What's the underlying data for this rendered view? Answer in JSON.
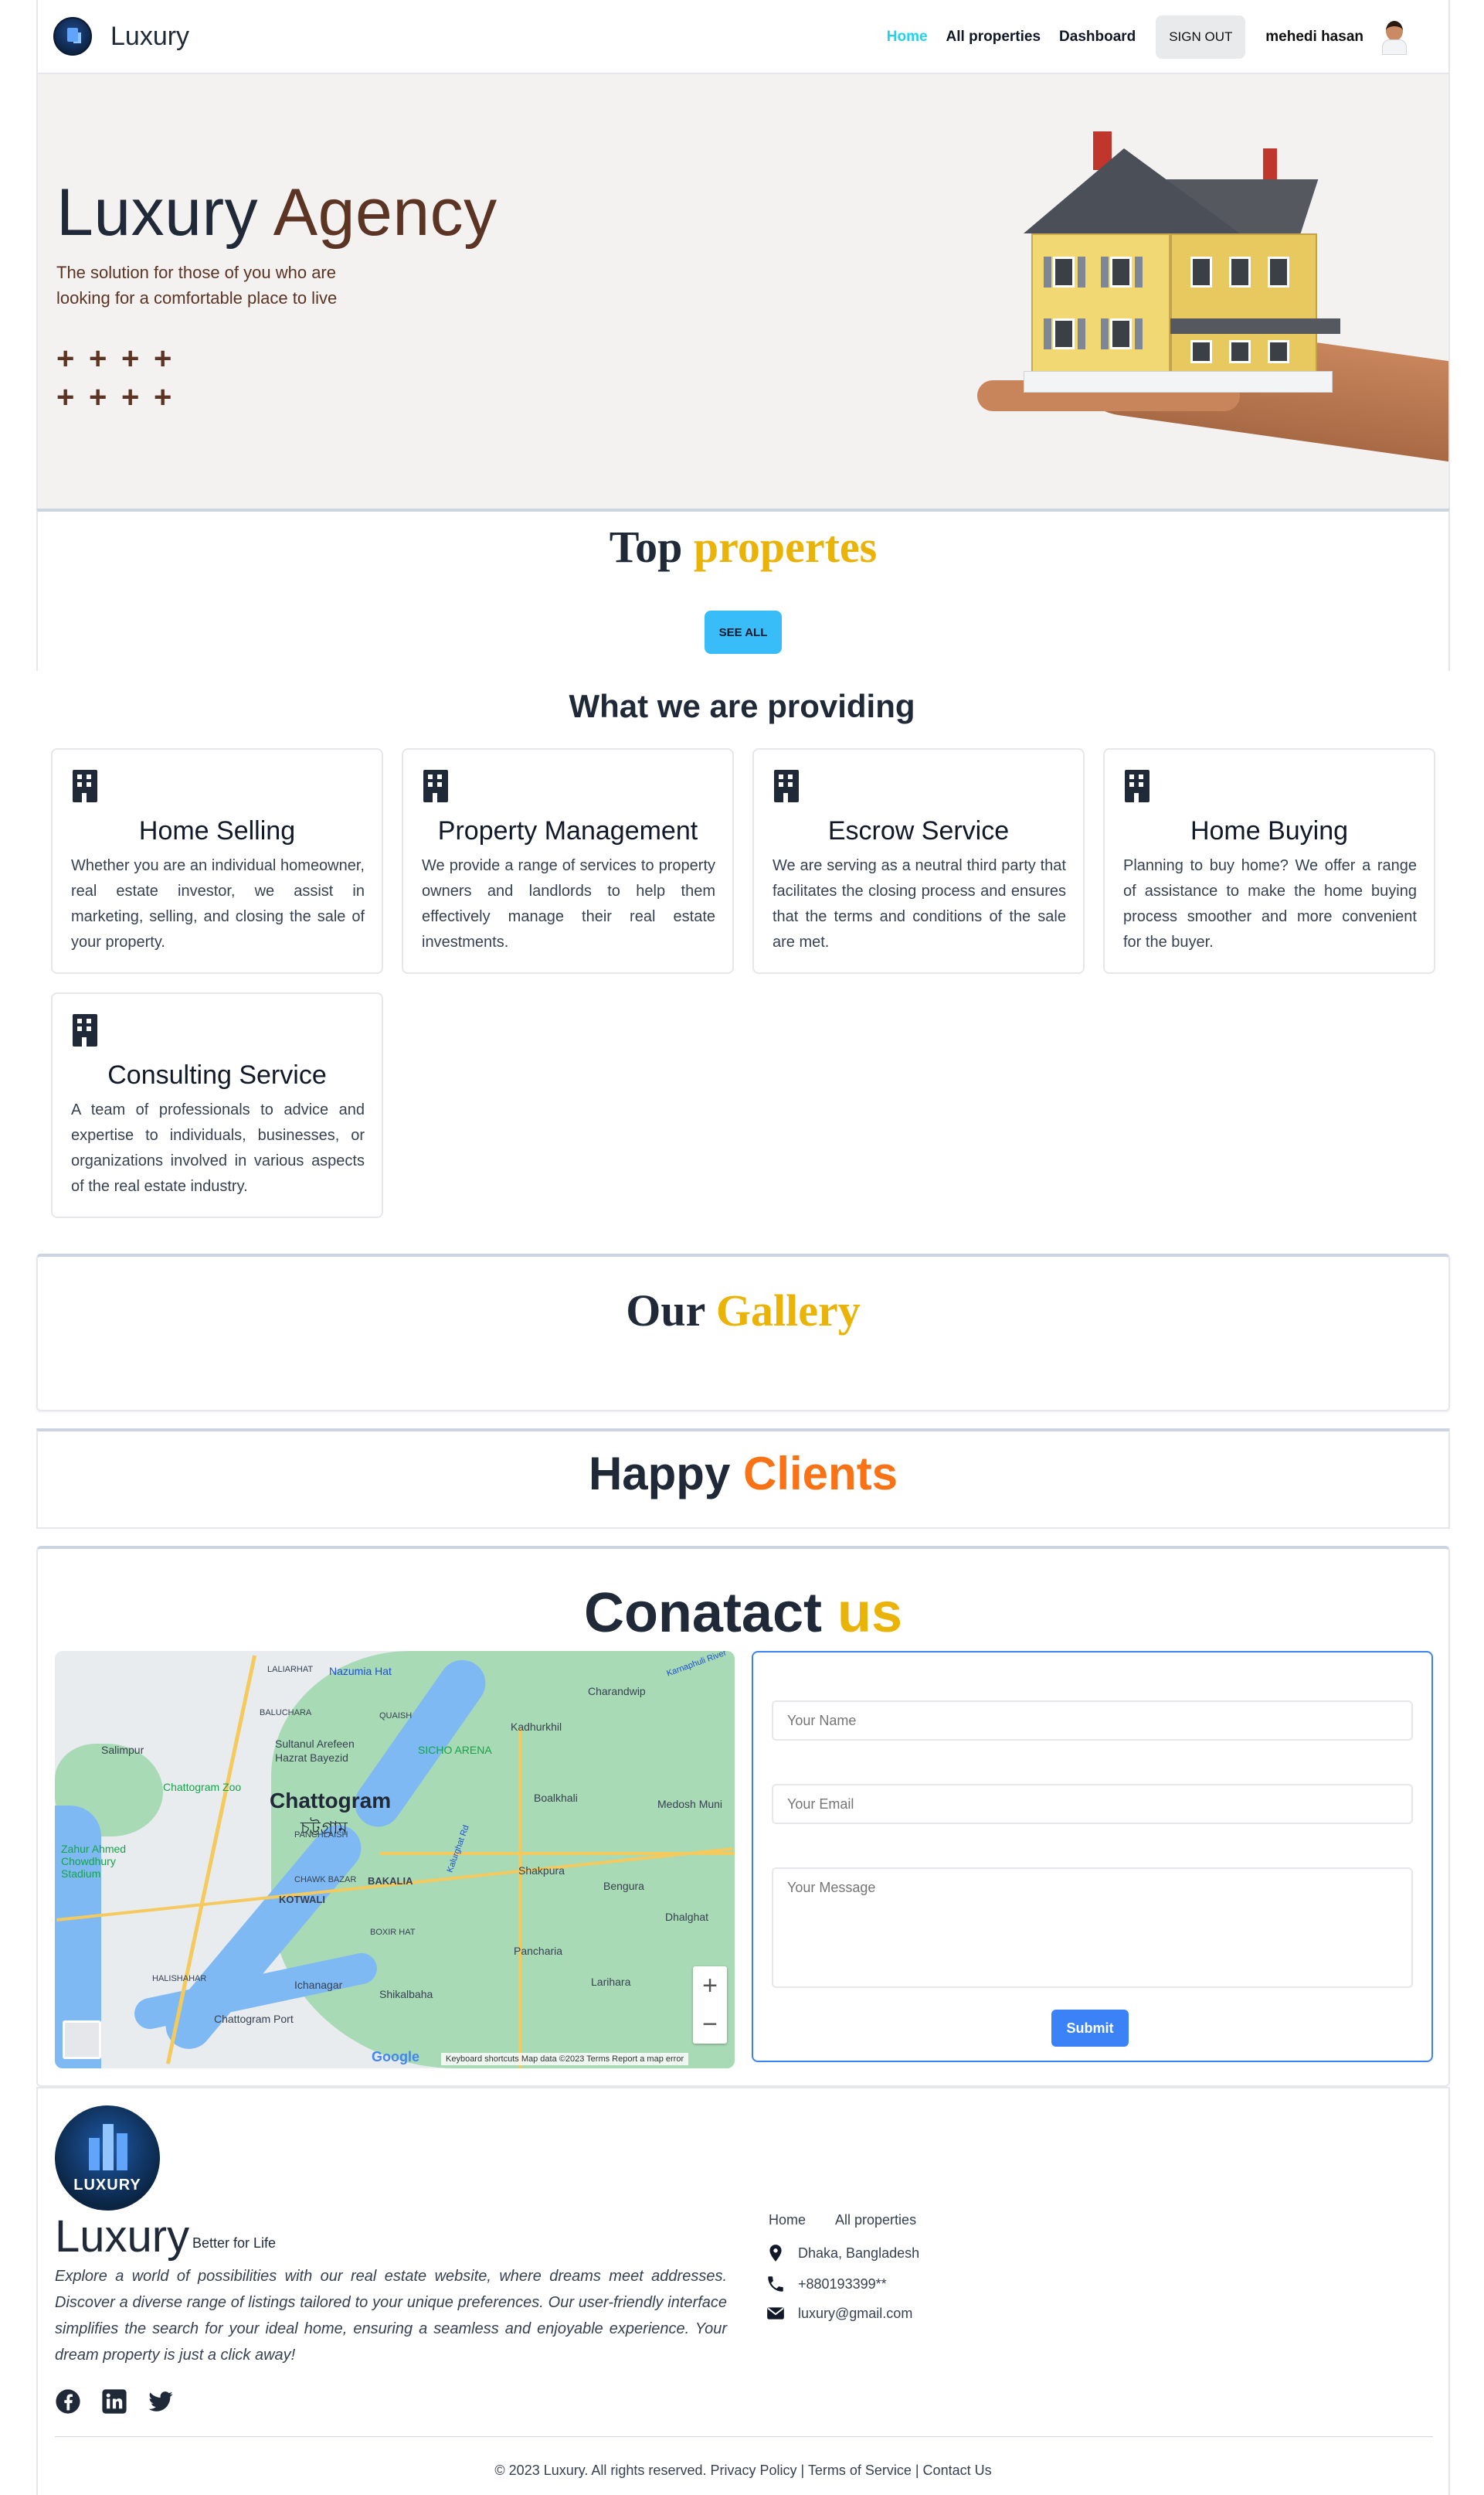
{
  "nav": {
    "brand": "Luxury",
    "links": [
      "Home",
      "All properties",
      "Dashboard"
    ],
    "signout": "SIGN OUT",
    "user": "mehedi hasan"
  },
  "hero": {
    "title_main": "Luxury",
    "title_accent": "Agency",
    "subtitle": "The solution for those of you who are looking for a comfortable place to live",
    "pluses": [
      "+",
      "+",
      "+",
      "+",
      "+",
      "+",
      "+",
      "+"
    ]
  },
  "top_properties": {
    "title_main": "Top",
    "title_accent": "propertes",
    "button": "SEE ALL"
  },
  "providing": {
    "title": "What we are providing",
    "cards": [
      {
        "title": "Home Selling",
        "text": "Whether you are an individual homeowner, real estate investor, we assist in marketing, selling, and closing the sale of your property."
      },
      {
        "title": "Property Management",
        "text": "We provide a range of services to property owners and landlords to help them effectively manage their real estate investments."
      },
      {
        "title": "Escrow Service",
        "text": "We are serving as a neutral third party that facilitates the closing process and ensures that the terms and conditions of the sale are met."
      },
      {
        "title": "Home Buying",
        "text": "Planning to buy home? We offer a range of assistance to make the home buying process smoother and more convenient for the buyer."
      },
      {
        "title": "Consulting Service",
        "text": "A team of professionals to advice and expertise to individuals, businesses, or organizations involved in various aspects of the real estate industry."
      }
    ]
  },
  "gallery": {
    "title_main": "Our",
    "title_accent": "Gallery"
  },
  "clients": {
    "title_main": "Happy",
    "title_accent": "Clients"
  },
  "contact": {
    "title_main": "Conatact",
    "title_accent": "us",
    "map": {
      "city": "Chattogram",
      "city_local": "চট্টগ্রাম",
      "labels": [
        "Nazumia Hat",
        "LALIARHAT",
        "BALUCHARA",
        "QUAISH",
        "Charandwip",
        "Kadhurkhil",
        "Sultanul Arefeen",
        "Hazrat Bayezid",
        "SICHO ARENA",
        "Salimpur",
        "Chattogram Zoo",
        "Boalkhali",
        "Medosh Muni",
        "Zahur Ahmed Chowdhury Stadium",
        "PANCHLAISH",
        "CHAWK BAZAR",
        "BAKALIA",
        "Shakpura",
        "KOTWALI",
        "Bengura",
        "BOXIR HAT",
        "Dhalghat",
        "Pancharia",
        "HALISHAHAR",
        "Ichanagar",
        "Lariharа",
        "Chattogram Port",
        "Shikalbaha",
        "Karnaphuli River",
        "Kalurghat Rd"
      ],
      "google": "Google",
      "footer": "Keyboard shortcuts   Map data ©2023   Terms   Report a map error",
      "zoom_in": "+",
      "zoom_out": "−"
    },
    "form": {
      "name_placeholder": "Your Name",
      "email_placeholder": "Your Email",
      "message_placeholder": "Your Message",
      "submit": "Submit"
    }
  },
  "footer": {
    "logo_text": "LUXURY",
    "brand": "Luxury",
    "tagline": "Better for Life",
    "description": "Explore a world of possibilities with our real estate website, where dreams meet addresses. Discover a diverse range of listings tailored to your unique preferences. Our user-friendly interface simplifies the search for your ideal home, ensuring a seamless and enjoyable experience. Your dream property is just a click away!",
    "links": [
      "Home",
      "All properties"
    ],
    "address": "Dhaka, Bangladesh",
    "phone": "+880193399**",
    "email": "luxury@gmail.com",
    "copyright": "© 2023 Luxury. All rights reserved. Privacy Policy | Terms of Service | Contact Us"
  },
  "colors": {
    "accent_cyan": "#22d3ee",
    "accent_yellow": "#eab308",
    "accent_orange": "#f97316",
    "hero_brown": "#5b3424",
    "button_blue": "#3b82f6",
    "see_all_blue": "#38bdf8"
  },
  "icons": [
    "building-icon",
    "location-pin-icon",
    "phone-icon",
    "mail-icon",
    "facebook-icon",
    "linkedin-icon",
    "twitter-icon"
  ]
}
